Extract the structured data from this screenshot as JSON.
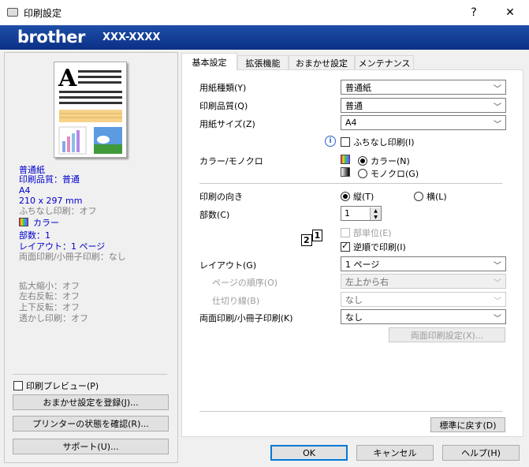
{
  "window": {
    "title": "印刷設定",
    "help": "?",
    "close": "✕"
  },
  "banner": {
    "brand": "brother",
    "model": "XXX-XXXX"
  },
  "tabs": [
    "基本設定",
    "拡張機能",
    "おまかせ設定",
    "メンテナンス"
  ],
  "summary": {
    "paper_type": "普通紙",
    "quality": "印刷品質：普通",
    "size": "A4",
    "dimensions": "210 x 297 mm",
    "borderless": "ふちなし印刷：オフ",
    "color": "カラー",
    "copies": "部数：1",
    "layout": "レイアウト：1 ページ",
    "duplex": "両面印刷/小冊子印刷：なし",
    "scale": "拡大縮小：オフ",
    "mirror": "左右反転：オフ",
    "flip": "上下反転：オフ",
    "watermark": "透かし印刷：オフ"
  },
  "left_buttons": {
    "preview_label": "印刷プレビュー(P)",
    "register": "おまかせ設定を登録(J)...",
    "status": "プリンターの状態を確認(R)...",
    "support": "サポート(U)..."
  },
  "form": {
    "media_type_label": "用紙種類(Y)",
    "media_type_value": "普通紙",
    "quality_label": "印刷品質(Q)",
    "quality_value": "普通",
    "size_label": "用紙サイズ(Z)",
    "size_value": "A4",
    "borderless_label": "ふちなし印刷(I)",
    "color_label": "カラー/モノクロ",
    "color_opt": "カラー(N)",
    "mono_opt": "モノクロ(G)",
    "orientation_label": "印刷の向き",
    "portrait": "縦(T)",
    "landscape": "横(L)",
    "copies_label": "部数(C)",
    "copies_value": "1",
    "collate": "部単位(E)",
    "reverse": "逆順で印刷(I)",
    "layout_label": "レイアウト(G)",
    "layout_value": "1 ページ",
    "page_order_label": "ページの順序(O)",
    "page_order_value": "左上から右",
    "border_label": "仕切り線(B)",
    "border_value": "なし",
    "duplex_label": "両面印刷/小冊子印刷(K)",
    "duplex_value": "なし",
    "duplex_settings": "両面印刷設定(X)...",
    "default": "標準に戻す(D)"
  },
  "footer": {
    "ok": "OK",
    "cancel": "キャンセル",
    "help": "ヘルプ(H)"
  }
}
